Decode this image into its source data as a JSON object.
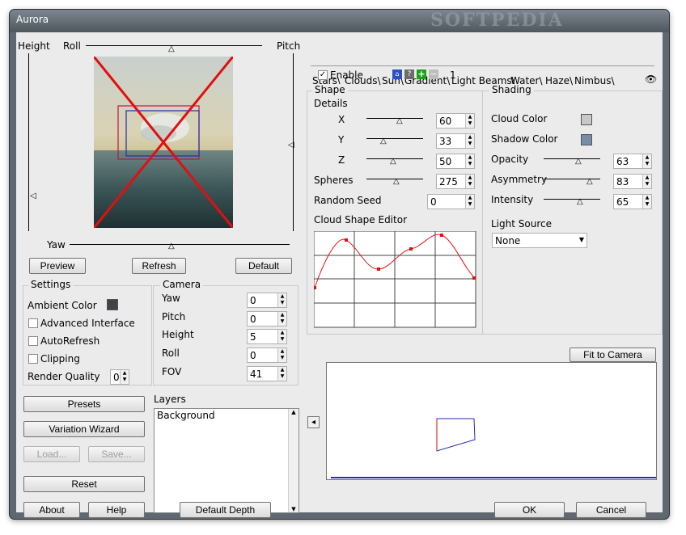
{
  "window": {
    "title": "Aurora",
    "watermark": "SOFTPEDIA"
  },
  "preview": {
    "label_height": "Height",
    "label_roll": "Roll",
    "label_pitch": "Pitch",
    "label_yaw": "Yaw",
    "buttons": {
      "preview": "Preview",
      "refresh": "Refresh",
      "default": "Default"
    }
  },
  "settings": {
    "title": "Settings",
    "ambient_color_label": "Ambient Color",
    "ambient_color": "#404448",
    "advanced_interface": "Advanced Interface",
    "autorefresh": "AutoRefresh",
    "clipping": "Clipping",
    "render_quality_label": "Render Quality",
    "render_quality": "0"
  },
  "camera": {
    "title": "Camera",
    "fields": [
      {
        "label": "Yaw",
        "value": "0"
      },
      {
        "label": "Pitch",
        "value": "0"
      },
      {
        "label": "Height",
        "value": "5"
      },
      {
        "label": "Roll",
        "value": "0"
      },
      {
        "label": "FOV",
        "value": "41"
      }
    ]
  },
  "left_buttons": {
    "presets": "Presets",
    "variation_wizard": "Variation Wizard",
    "load": "Load...",
    "save": "Save...",
    "reset": "Reset"
  },
  "layers": {
    "title": "Layers",
    "items": [
      "Background"
    ]
  },
  "tabs": [
    "Stars",
    "Clouds",
    "Sun",
    "Gradient",
    "Light Beams",
    "Water",
    "Haze",
    "Nimbus"
  ],
  "tab_active": "Nimbus",
  "enable_label": "Enable",
  "layer_tab": "1",
  "shape": {
    "title": "Shape",
    "details": "Details",
    "fields": [
      {
        "label": "X",
        "value": "60"
      },
      {
        "label": "Y",
        "value": "33"
      },
      {
        "label": "Z",
        "value": "50"
      },
      {
        "label": "Spheres",
        "value": "275"
      }
    ],
    "random_seed_label": "Random Seed",
    "random_seed": "0",
    "editor_label": "Cloud Shape Editor"
  },
  "shading": {
    "title": "Shading",
    "cloud_color_label": "Cloud Color",
    "cloud_color": "#c8c8c8",
    "shadow_color_label": "Shadow Color",
    "shadow_color": "#7a8ca6",
    "fields": [
      {
        "label": "Opacity",
        "value": "63"
      },
      {
        "label": "Asymmetry",
        "value": "83"
      },
      {
        "label": "Intensity",
        "value": "65"
      }
    ],
    "light_source_label": "Light Source",
    "light_source": "None"
  },
  "fit_to_camera": "Fit to Camera",
  "bottom_buttons": {
    "about": "About",
    "help": "Help",
    "default_depth": "Default Depth",
    "ok": "OK",
    "cancel": "Cancel"
  }
}
